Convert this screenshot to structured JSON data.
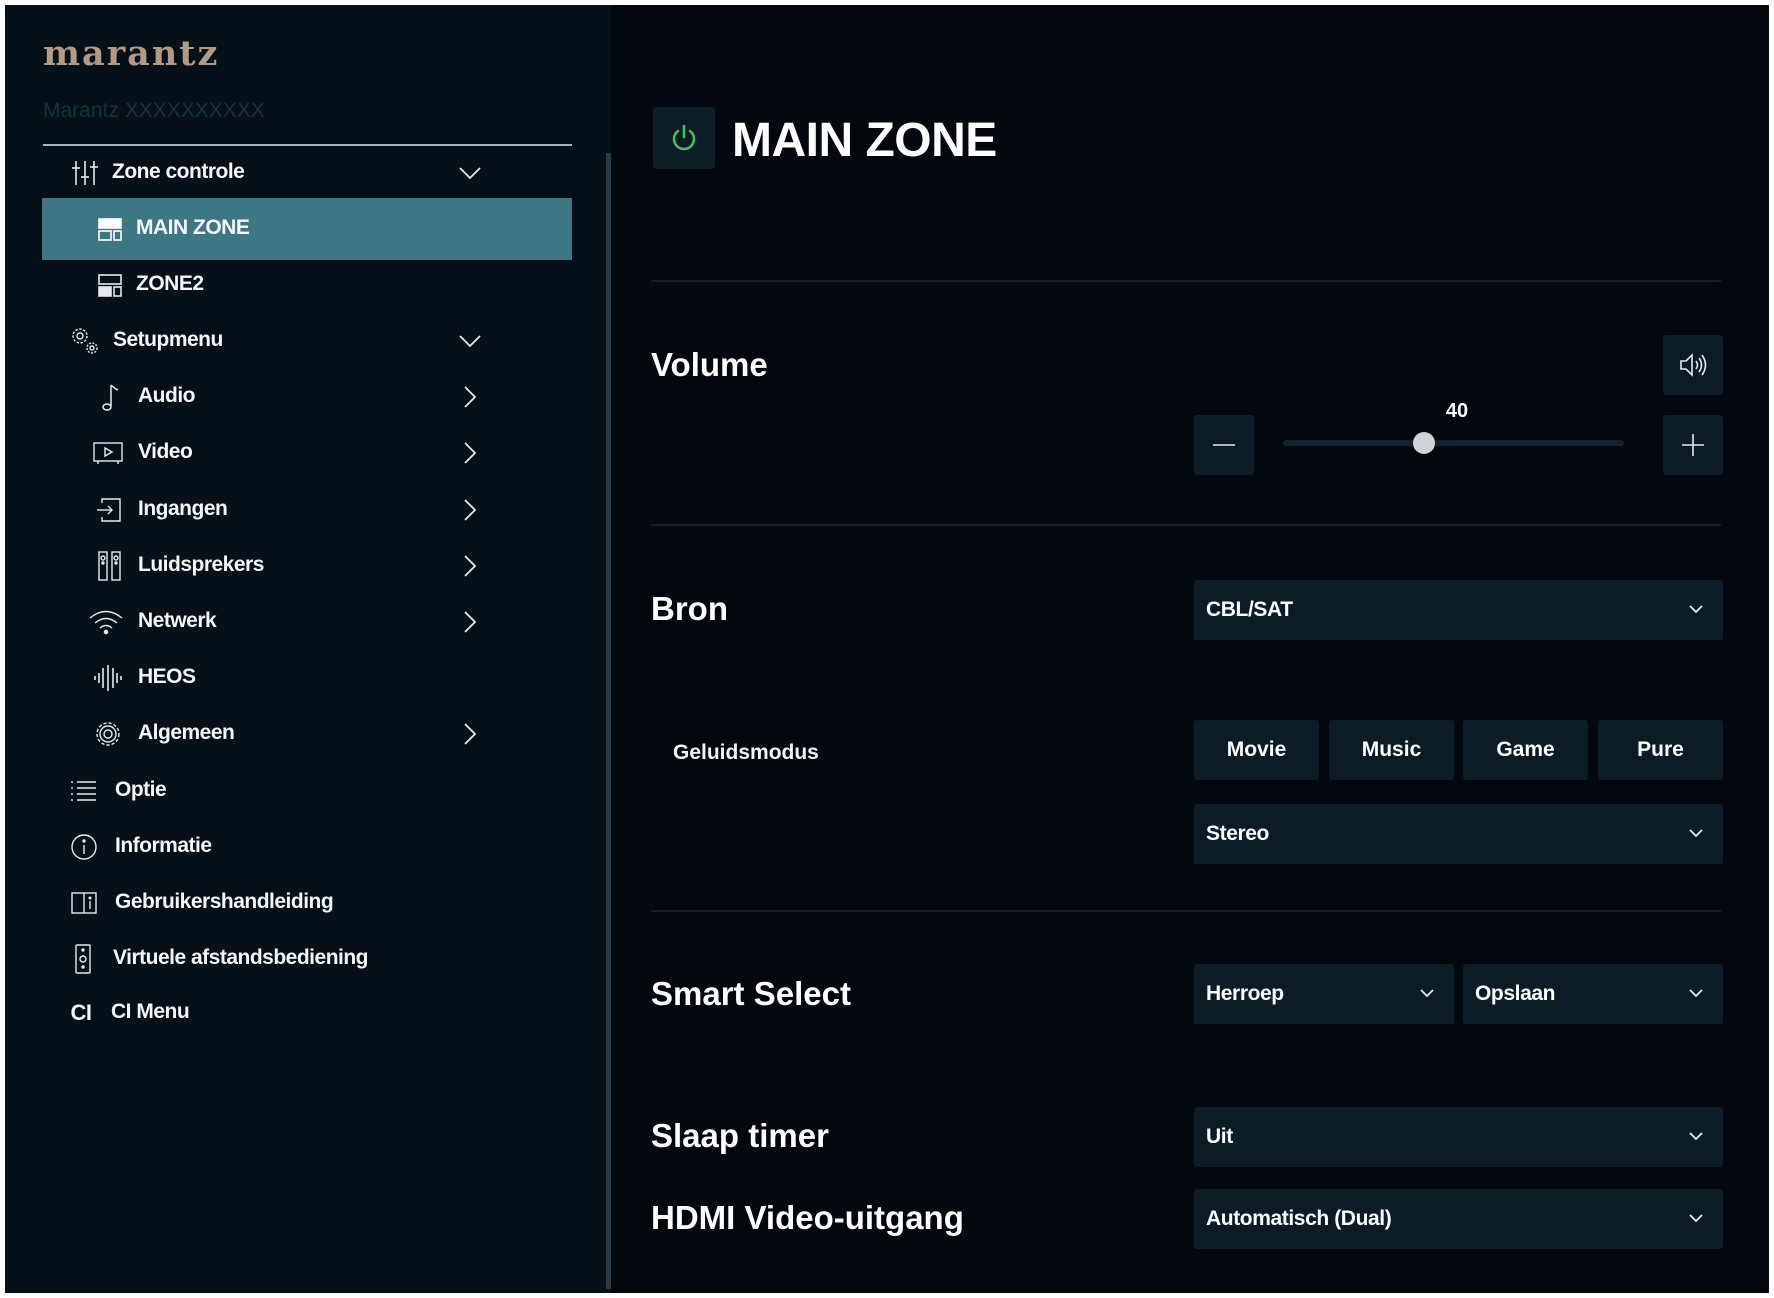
{
  "sidebar": {
    "brand": "marantz",
    "model": "Marantz XXXXXXXXXX",
    "items": [
      {
        "label": "Zone controle",
        "icon": "sliders-icon"
      },
      {
        "label": "MAIN ZONE",
        "icon": "zone-icon",
        "active": true
      },
      {
        "label": "ZONE2",
        "icon": "zone-icon"
      },
      {
        "label": "Setupmenu",
        "icon": "gears-icon"
      },
      {
        "label": "Audio",
        "icon": "music-note-icon"
      },
      {
        "label": "Video",
        "icon": "video-icon"
      },
      {
        "label": "Ingangen",
        "icon": "input-icon"
      },
      {
        "label": "Luidsprekers",
        "icon": "speakers-icon"
      },
      {
        "label": "Netwerk",
        "icon": "wifi-icon"
      },
      {
        "label": "HEOS",
        "icon": "heos-icon"
      },
      {
        "label": "Algemeen",
        "icon": "gear-icon"
      },
      {
        "label": "Optie",
        "icon": "list-icon"
      },
      {
        "label": "Informatie",
        "icon": "info-icon"
      },
      {
        "label": "Gebruikershandleiding",
        "icon": "manual-icon"
      },
      {
        "label": "Virtuele afstandsbediening",
        "icon": "remote-icon"
      },
      {
        "label": "CI Menu",
        "icon_text": "CI"
      }
    ]
  },
  "main": {
    "title": "MAIN ZONE",
    "volume": {
      "label": "Volume",
      "value": "40",
      "level": 40,
      "max": 98
    },
    "source": {
      "label": "Bron",
      "value": "CBL/SAT"
    },
    "sound_mode": {
      "label": "Geluidsmodus",
      "buttons": [
        "Movie",
        "Music",
        "Game",
        "Pure"
      ],
      "value": "Stereo"
    },
    "smart_select": {
      "label": "Smart Select",
      "recall": "Herroep",
      "save": "Opslaan"
    },
    "sleep_timer": {
      "label": "Slaap timer",
      "value": "Uit"
    },
    "hdmi_output": {
      "label": "HDMI Video-uitgang",
      "value": "Automatisch (Dual)"
    }
  },
  "colors": {
    "background": "#03080f",
    "sidebar": "#051018",
    "active_item": "#3d7784",
    "control": "#0c1c26",
    "power_green": "#3fbf55",
    "brand": "#b29a86"
  }
}
